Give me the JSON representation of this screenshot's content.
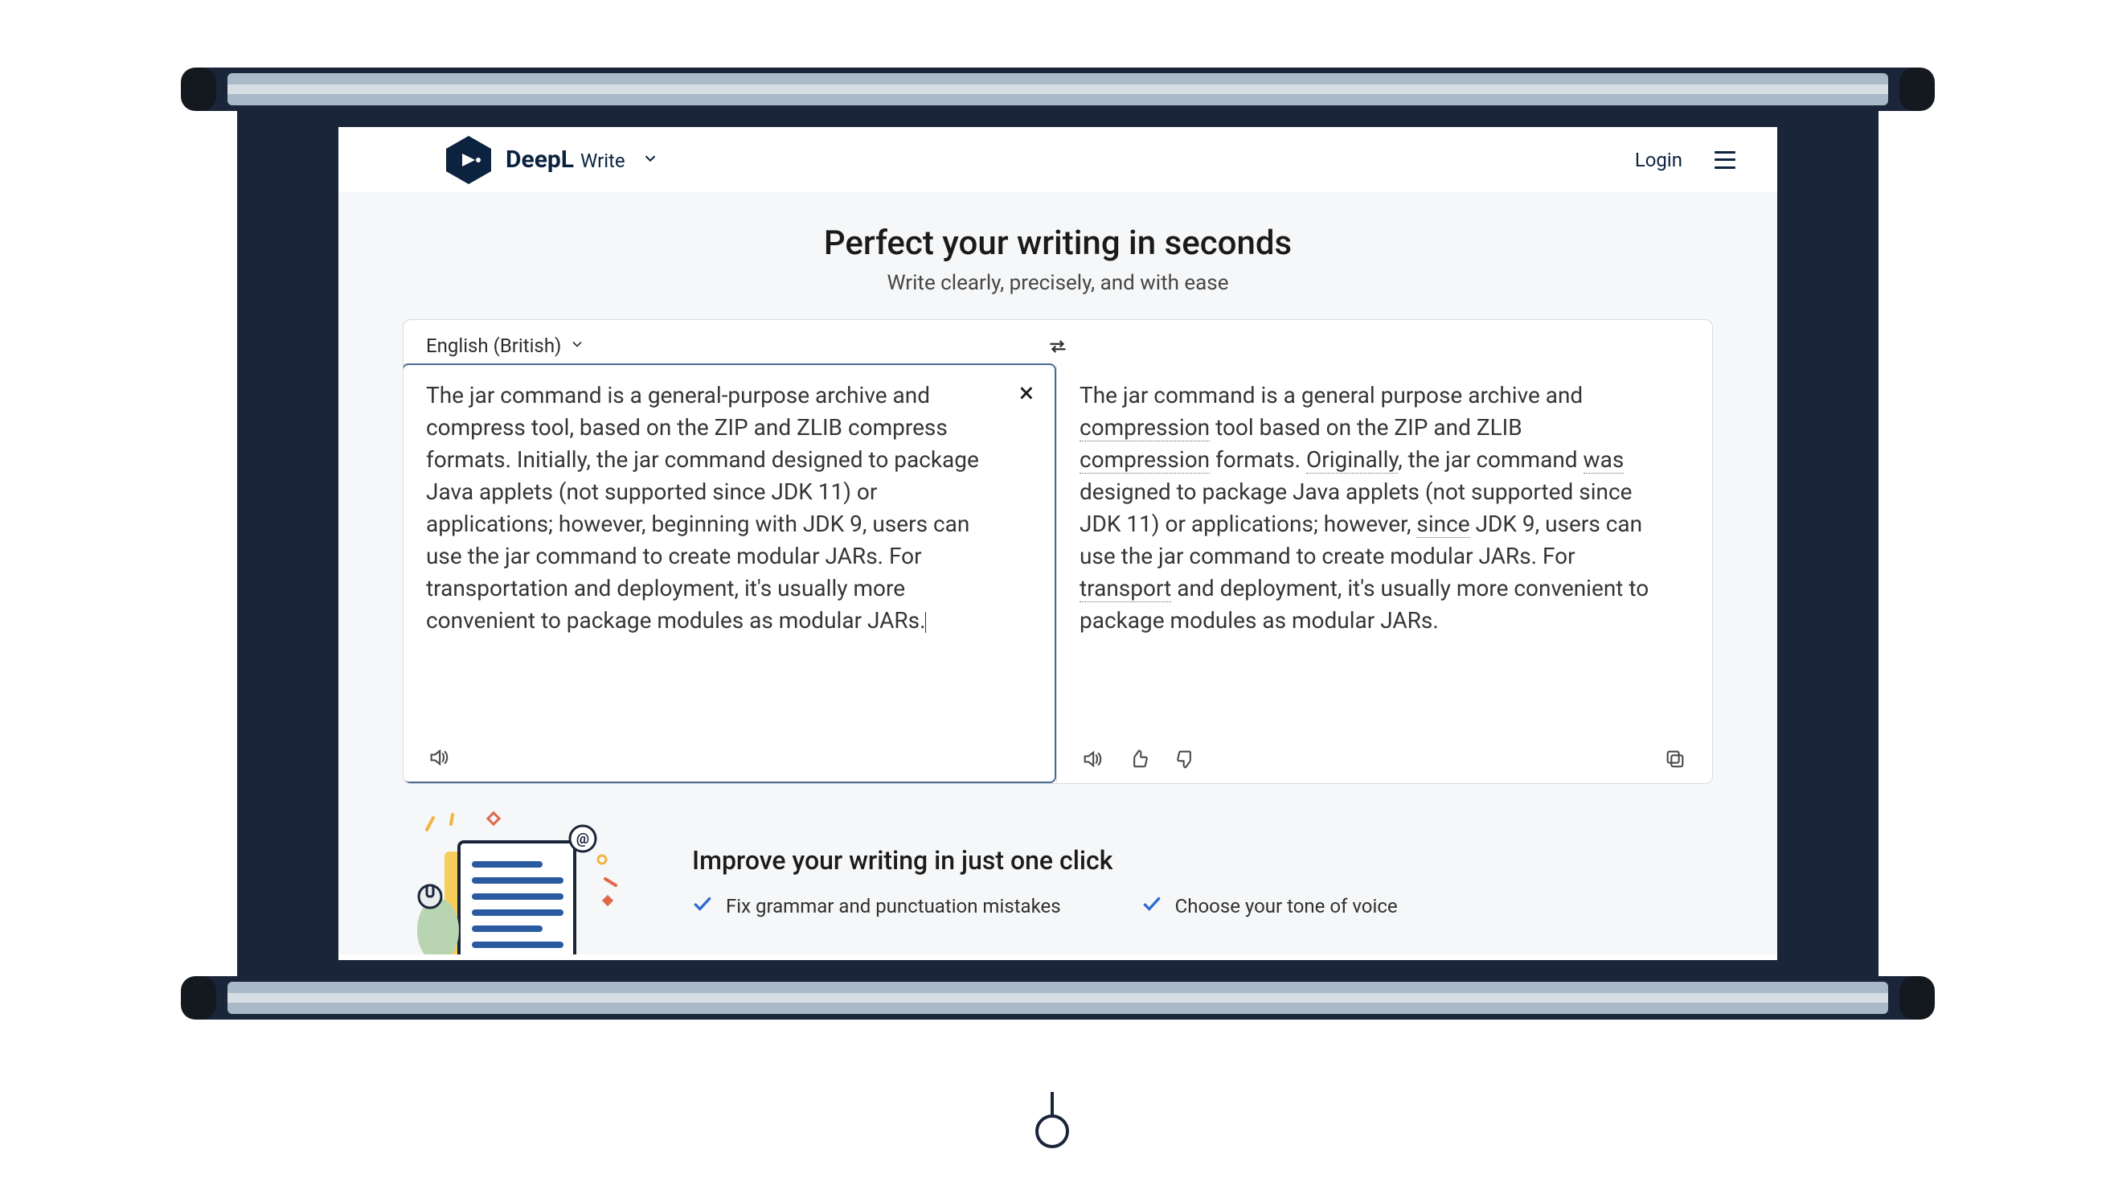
{
  "header": {
    "brand": "DeepL",
    "product": "Write",
    "login_label": "Login"
  },
  "hero": {
    "title": "Perfect your writing in seconds",
    "subtitle": "Write clearly, precisely, and with ease"
  },
  "editor": {
    "language_label": "English (British)",
    "input_text": "The jar command is a general-purpose archive and compress tool, based on the ZIP and ZLIB compress formats. Initially, the jar command designed to package Java applets (not supported since JDK 11) or applications; however, beginning with JDK 9, users can use the jar command to create modular JARs. For transportation and deployment, it's usually more convenient to package modules as modular JARs.",
    "output_segments": [
      {
        "t": "The jar command is a general purpose archive and "
      },
      {
        "t": "compression",
        "u": true
      },
      {
        "t": " tool based on the ZIP and ZLIB "
      },
      {
        "t": "compression",
        "u": true
      },
      {
        "t": " formats. "
      },
      {
        "t": "Originally",
        "u": true
      },
      {
        "t": ", the jar command "
      },
      {
        "t": "was",
        "u": true
      },
      {
        "t": " designed to package Java applets (not supported since JDK 11) or applications; however, "
      },
      {
        "t": "since",
        "u": true
      },
      {
        "t": " JDK 9, users can use the jar command to create modular JARs. For "
      },
      {
        "t": "transport",
        "u": true
      },
      {
        "t": " and deployment, it's usually more convenient to package modules as modular JARs."
      }
    ]
  },
  "promo": {
    "title": "Improve your writing in just one click",
    "items": [
      "Fix grammar and punctuation mistakes",
      "Choose your tone of voice"
    ]
  },
  "icons": {
    "chevron": "chevron-down",
    "swap": "swap-horizontal",
    "speaker": "speaker",
    "thumb_up": "thumb-up",
    "thumb_down": "thumb-down",
    "copy": "copy",
    "close": "×"
  }
}
